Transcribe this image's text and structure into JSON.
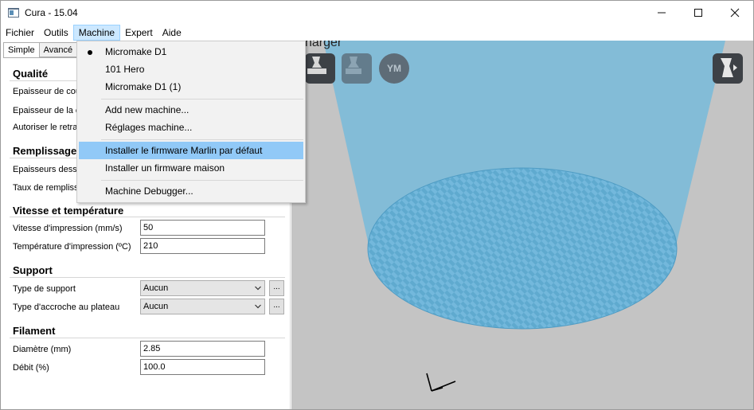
{
  "window": {
    "title": "Cura - 15.04",
    "minimize": "—",
    "maximize": "☐",
    "close": "✕"
  },
  "menubar": {
    "items": [
      "Fichier",
      "Outils",
      "Machine",
      "Expert",
      "Aide"
    ]
  },
  "tabs": [
    "Simple",
    "Avancé"
  ],
  "settings": {
    "quality": {
      "title": "Qualité",
      "labels": [
        "Epaisseur de cou",
        "Epaisseur de la c",
        "Autoriser le retra"
      ]
    },
    "fill": {
      "title": "Remplissage",
      "labels": [
        "Epaisseurs dessu",
        "Taux de rempliss"
      ]
    },
    "speed": {
      "title": "Vitesse et température",
      "print_speed_label": "Vitesse d'impression (mm/s)",
      "print_speed_value": "50",
      "print_temp_label": "Température d'impression (ºC)",
      "print_temp_value": "210"
    },
    "support": {
      "title": "Support",
      "support_type_label": "Type de support",
      "support_type_value": "Aucun",
      "adhesion_label": "Type d'accroche au plateau",
      "adhesion_value": "Aucun",
      "more_label": "..."
    },
    "filament": {
      "title": "Filament",
      "diameter_label": "Diamètre (mm)",
      "diameter_value": "2.85",
      "flow_label": "Débit (%)",
      "flow_value": "100.0"
    }
  },
  "viewport": {
    "load_label": "harger",
    "ym_label": "YM",
    "icons": [
      "load-icon",
      "print-icon",
      "youmagine-icon",
      "view-mode-icon"
    ],
    "colors": {
      "background": "#c4c4c4",
      "volume": "#7fbcd8",
      "plate_a": "#73b8dc",
      "plate_b": "#5faacf"
    }
  },
  "machine_menu": {
    "machines": [
      "Micromake D1",
      "101 Hero",
      "Micromake D1 (1)"
    ],
    "selected_machine": "Micromake D1",
    "add_machine": "Add new machine...",
    "machine_settings": "Réglages machine...",
    "install_default_firmware": "Installer le firmware Marlin par défaut",
    "install_custom_firmware": "Installer un firmware maison",
    "debugger": "Machine Debugger..."
  }
}
